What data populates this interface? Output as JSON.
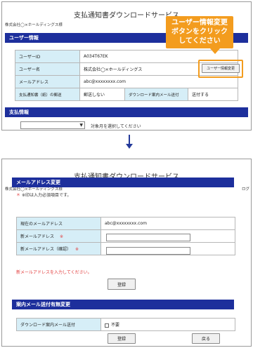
{
  "service_title": "支払通知書ダウンロードサービス",
  "company_name": "株式会社◯×ホールディングス様",
  "top": {
    "user_section_title": "ユーザー情報",
    "rows": {
      "user_id_label": "ユーザーID",
      "user_id_value": "A034T67EK",
      "user_name_label": "ユーザー名",
      "user_name_value": "株式会社◯×ホールディングス",
      "email_label": "メールアドレス",
      "email_value": "abc@xxxxxxxx.com",
      "mail_label": "支払通知書（紙）の郵送",
      "mail_value": "郵送しない",
      "notify_label": "ダウンロード案内メール送付",
      "notify_value": "送付する"
    },
    "user_info_change_button": "ユーザー情報変更",
    "callout_lines": [
      "ユーザー情報変更",
      "ボタンをクリック",
      "してください"
    ],
    "payment_section_title": "支払情報",
    "select_hint": "対象月を選択してください",
    "accent_color": "#f39c1e",
    "bar_color": "#1d2f9c"
  },
  "bottom": {
    "top_right_link": "ログ",
    "email_section_title": "メールアドレス変更",
    "required_note_mark": "＊",
    "required_note_text": "※印は入力必須項目です。",
    "rows": {
      "current_email_label": "現在のメールアドレス",
      "current_email_value": "abc@xxxxxxxx.com",
      "new_email_label": "新メールアドレス",
      "new_email_confirm_label": "新メールアドレス（確認）",
      "required_mark": "※"
    },
    "error_message": "新メールアドレスを入力してください。",
    "register_button": "登録",
    "mail_notify_section_title": "案内メール送付有無変更",
    "notify_label": "ダウンロード案内メール送付",
    "notify_option": "不要",
    "register_button_2": "登録",
    "back_button": "戻る"
  }
}
